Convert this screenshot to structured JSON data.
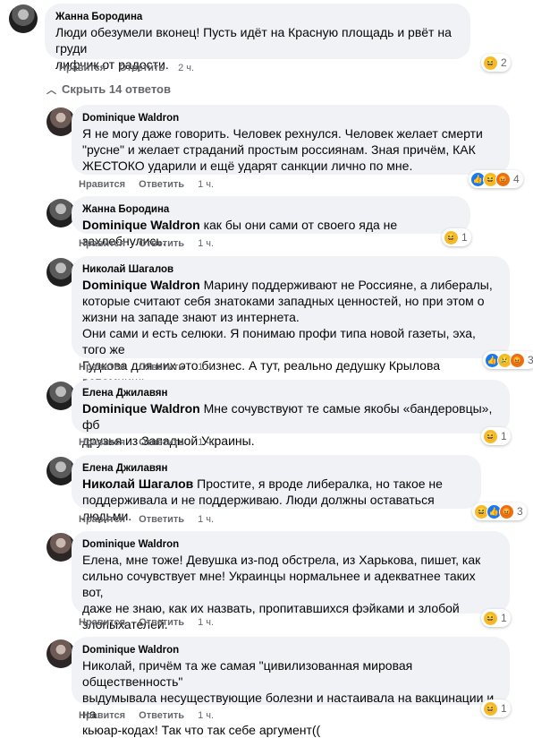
{
  "comments": [
    {
      "author": "Жанна Бородина",
      "mention": "",
      "text_lines": [
        "Люди обезумели вконец! Пусть идёт на Красную площадь и рвёт на груди",
        "лифчик от радости."
      ],
      "like": "Нравится",
      "reply": "Ответить",
      "time": "2 ч.",
      "reactions": "2"
    },
    {
      "author": "Dominique Waldron",
      "mention": "",
      "text_lines": [
        "Я не могу даже говорить. Человек рехнулся. Человек желает смерти",
        "\"русне\" и желает страданий простым россиянам. Зная причём, КАК",
        "ЖЕСТОКО ударили и ещё ударят санкции лично по мне."
      ],
      "like": "Нравится",
      "reply": "Ответить",
      "time": "1 ч.",
      "reactions": "4"
    },
    {
      "author": "Жанна Бородина",
      "mention": "Dominique Waldron",
      "text_lines": [
        " как бы они сами от своего яда не захлебнулись."
      ],
      "like": "Нравится",
      "reply": "Ответить",
      "time": "1 ч.",
      "reactions": "1"
    },
    {
      "author": "Николай Шагалов",
      "mention": "Dominique Waldron",
      "text_lines": [
        " Марину поддерживают не Россияне, а либералы,",
        "которые считают себя знатоками западных ценностей, но при этом о",
        "жизни на западе знают из интернета.",
        "Они сами и есть селюки. Я понимаю профи типа новой газеты, эха, того же",
        "Гудкова для них это бизнес. А тут, реально дедушку Крылова вспомнишь"
      ],
      "like": "Нравится",
      "reply": "Ответить",
      "time": "1 ч.",
      "reactions": "3"
    },
    {
      "author": "Елена Джилавян",
      "mention": "Dominique Waldron",
      "text_lines": [
        " Мне сочувствуют те самые якобы «бандеровцы», фб",
        "друзья из Западной Украины."
      ],
      "like": "Нравится",
      "reply": "Ответить",
      "time": "1 ч.",
      "reactions": "1"
    },
    {
      "author": "Елена Джилавян",
      "mention": "Николай Шагалов",
      "text_lines": [
        " Простите, я вроде либералка, но такое не",
        "поддерживала и не поддерживаю. Люди должны оставаться людьми."
      ],
      "like": "Нравится",
      "reply": "Ответить",
      "time": "1 ч.",
      "reactions": "3"
    },
    {
      "author": "Dominique Waldron",
      "mention": "",
      "text_lines": [
        "Елена, мне тоже! Девушка из-под обстрела, из Харькова, пишет, как",
        "сильно сочувствует мне! Украинцы нормальнее и адекватнее таких вот,",
        "даже не знаю, как их назвать, пропитавшихся фэйками и злобой",
        "злопыхателей."
      ],
      "like": "Нравится",
      "reply": "Ответить",
      "time": "1 ч.",
      "reactions": "1"
    },
    {
      "author": "Dominique Waldron",
      "mention": "",
      "text_lines": [
        "Николай, причём та же самая \"цивилизованная мировая общественность\"",
        "выдумывала несуществующие болезни и настаивала на вакцинации и на",
        "кьюар-кодах! Так что так себе аргумент(("
      ],
      "like": "Нравится",
      "reply": "Ответить",
      "time": "1 ч.",
      "reactions": "1"
    }
  ],
  "hide_replies": "Скрыть 14 ответов"
}
